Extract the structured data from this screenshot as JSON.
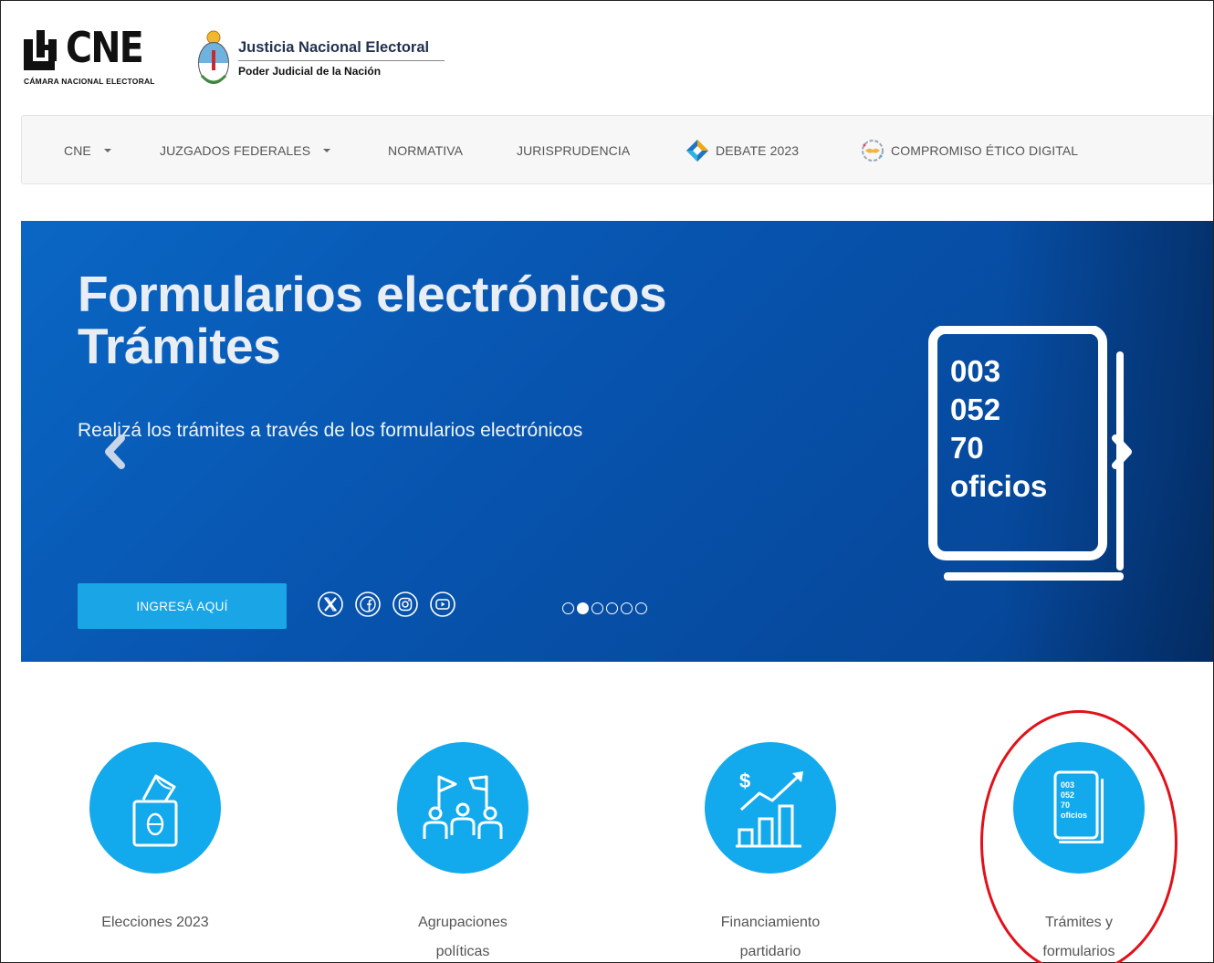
{
  "header": {
    "cne_logo_text": "CNE",
    "cne_logo_subtitle": "CÁMARA NACIONAL ELECTORAL",
    "jne_title": "Justicia Nacional Electoral",
    "jne_subtitle": "Poder Judicial de la Nación"
  },
  "nav": {
    "items": [
      {
        "label": "CNE",
        "has_dropdown": true
      },
      {
        "label": "JUZGADOS FEDERALES",
        "has_dropdown": true
      },
      {
        "label": "NORMATIVA",
        "has_dropdown": false
      },
      {
        "label": "JURISPRUDENCIA",
        "has_dropdown": false
      },
      {
        "label": "DEBATE 2023",
        "icon": "debate-diamond-icon"
      },
      {
        "label": "COMPROMISO ÉTICO DIGITAL",
        "icon": "compromiso-handshake-icon"
      }
    ]
  },
  "hero": {
    "title_line1": "Formularios electrónicos",
    "title_line2": "Trámites",
    "subtitle": "Realizá los trámites a través de los formularios electrónicos",
    "cta_label": "INGRESÁ AQUÍ",
    "graphic_lines": [
      "003",
      "052",
      "70",
      "oficios"
    ],
    "social_icons": [
      "x-icon",
      "facebook-icon",
      "instagram-icon",
      "youtube-icon"
    ],
    "slide_count": 6,
    "active_slide": 2,
    "colors": {
      "background": "#0753ad",
      "cta": "#1aa6e6"
    }
  },
  "tiles": [
    {
      "label_line1": "Elecciones 2023",
      "label_line2": "",
      "icon": "ballot-box-icon"
    },
    {
      "label_line1": "Agrupaciones",
      "label_line2": "políticas",
      "icon": "political-groups-icon"
    },
    {
      "label_line1": "Financiamiento",
      "label_line2": "partidario",
      "icon": "financing-chart-icon"
    },
    {
      "label_line1": "Trámites y",
      "label_line2": "formularios",
      "icon": "forms-tablet-icon"
    }
  ],
  "tile_color": "#12aaed",
  "highlight_color": "#e3101a"
}
